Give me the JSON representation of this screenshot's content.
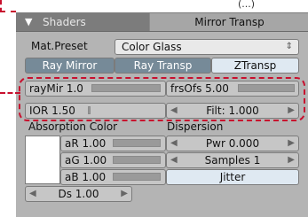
{
  "top_strip": {
    "label": "(...)"
  },
  "tabs": [
    {
      "label": "Shaders"
    },
    {
      "label": "Mirror Transp"
    }
  ],
  "mat_preset": {
    "label": "Mat.Preset",
    "value": "Color Glass"
  },
  "toggle_buttons": [
    {
      "label": "Ray Mirror",
      "active": false
    },
    {
      "label": "Ray Transp",
      "active": false
    },
    {
      "label": "ZTransp",
      "active": true
    }
  ],
  "fields": {
    "raymir": {
      "label": "rayMir 1.0",
      "value": 1.0
    },
    "frsofs": {
      "label": "frsOfs 5.00",
      "value": 5.0
    },
    "ior": {
      "label": "IOR 1.50",
      "value": 1.5
    },
    "filt": {
      "label": "Filt: 1.000",
      "value": 1.0
    }
  },
  "absorption": {
    "title": "Absorption Color",
    "swatch_color": "#ffffff",
    "ar": {
      "label": "aR 1.00",
      "value": 1.0
    },
    "ag": {
      "label": "aG 1.00",
      "value": 1.0
    },
    "ab": {
      "label": "aB 1.00",
      "value": 1.0
    },
    "ds": {
      "label": "Ds 1.00",
      "value": 1.0
    }
  },
  "dispersion": {
    "title": "Dispersion",
    "pwr": {
      "label": "Pwr 0.000",
      "value": 0.0
    },
    "samples": {
      "label": "Samples 1",
      "value": 1
    },
    "jitter": {
      "label": "Jitter"
    }
  },
  "icons": {
    "collapse": "triangle-down-icon",
    "dropdown": "updown-arrows-icon",
    "left": "arrow-left-icon",
    "right": "arrow-right-icon"
  },
  "colors": {
    "panel_bg": "#b4b4b4",
    "tab_bg": "#7c7c7c",
    "button_bg": "#768a98",
    "active_button_bg": "#dfe9f2",
    "highlight_dash": "#c8102e"
  }
}
